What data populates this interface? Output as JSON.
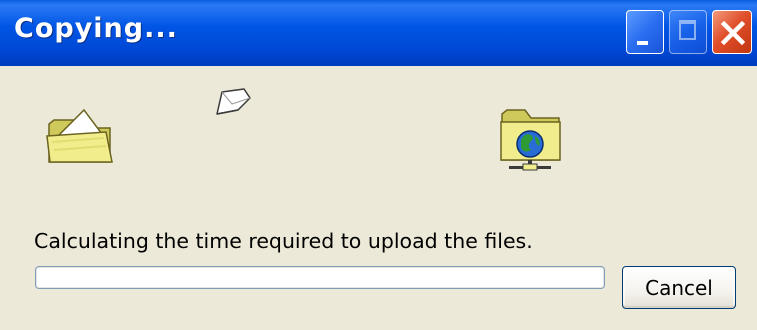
{
  "window": {
    "title": "Copying...",
    "controls": {
      "minimize_icon": "minimize-icon",
      "maximize_icon": "maximize-icon",
      "close_icon": "close-icon"
    }
  },
  "icons": {
    "source": "folder-open-icon",
    "flying_document": "document-icon",
    "destination": "web-folder-icon"
  },
  "status": {
    "message": "Calculating the time required to upload the files."
  },
  "progress": {
    "value": 0
  },
  "buttons": {
    "cancel_label": "Cancel"
  },
  "colors": {
    "titlebar": "#0055e5",
    "dialog_background": "#ece9d8",
    "close_button": "#e0502b",
    "folder_yellow": "#f2ed8c",
    "progress_fill": "#2fc42f"
  }
}
